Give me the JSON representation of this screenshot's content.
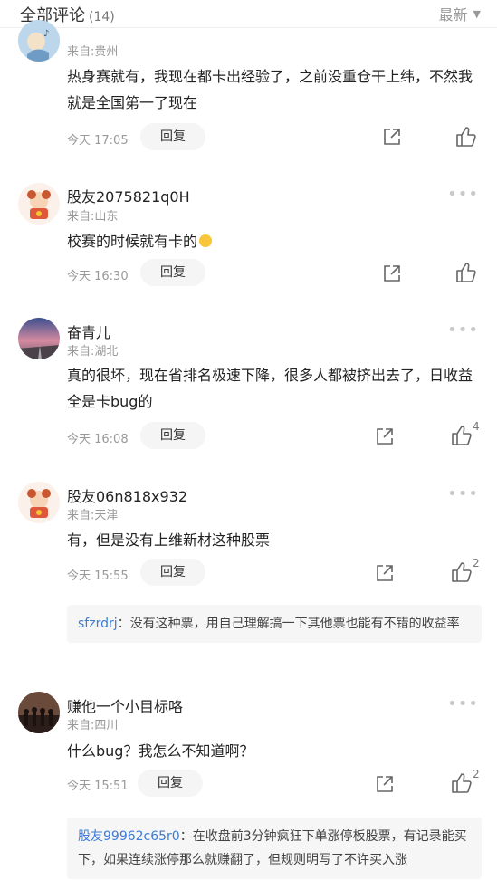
{
  "header": {
    "title": "全部评论",
    "count": "(14)",
    "sort_label": "最新"
  },
  "comments": [
    {
      "name": "",
      "location": "来自:贵州",
      "text": "热身赛就有，我现在都卡出经验了，之前没重仓干上纬，不然我就是全国第一了现在",
      "time": "今天 17:05",
      "reply_label": "回复",
      "likes": ""
    },
    {
      "name": "股友2075821q0H",
      "location": "来自:山东",
      "text": "校赛的时候就有卡的",
      "time": "今天 16:30",
      "reply_label": "回复",
      "likes": ""
    },
    {
      "name": "奋青儿",
      "location": "来自:湖北",
      "text": "真的很坏，现在省排名极速下降，很多人都被挤出去了，日收益全是卡bug的",
      "time": "今天 16:08",
      "reply_label": "回复",
      "likes": "4"
    },
    {
      "name": "股友06n818x932",
      "location": "来自:天津",
      "text": "有，但是没有上维新材这种股票",
      "time": "今天 15:55",
      "reply_label": "回复",
      "likes": "2",
      "sub_reply": {
        "name": "sfzrdrj",
        "text": "：没有这种票，用自己理解搞一下其他票也能有不错的收益率"
      }
    },
    {
      "name": "赚他一个小目标咯",
      "location": "来自:四川",
      "text": "什么bug？我怎么不知道啊？",
      "time": "今天 15:51",
      "reply_label": "回复",
      "likes": "2",
      "sub_reply": {
        "name": "股友99962c65r0",
        "text": "：在收盘前3分钟疯狂下单涨停板股票，有记录能买下，如果连续涨停那么就赚翻了，但规则明写了不许买入涨"
      }
    }
  ]
}
